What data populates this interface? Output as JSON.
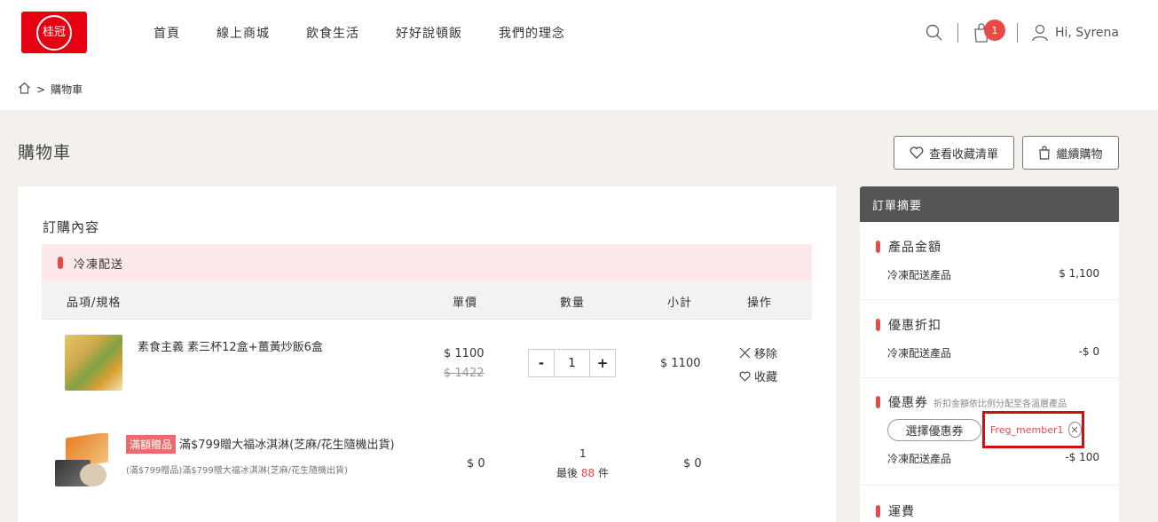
{
  "header": {
    "logo_text": "桂冠",
    "nav": [
      "首頁",
      "線上商城",
      "飲食生活",
      "好好說頓飯",
      "我們的理念"
    ],
    "cart_count": "1",
    "greeting": "Hi, Syrena"
  },
  "breadcrumb": {
    "separator": ">",
    "current": "購物車"
  },
  "page": {
    "title": "購物車",
    "view_favorites": "查看收藏清單",
    "continue_shopping": "繼續購物"
  },
  "order": {
    "title": "訂購內容",
    "shipping_group": "冷凍配送",
    "columns": {
      "item": "品項/規格",
      "unit_price": "單價",
      "quantity": "數量",
      "subtotal": "小計",
      "actions": "操作"
    },
    "items": [
      {
        "name": "素食主義 素三杯12盒+薑黃炒飯6盒",
        "price": "$ 1100",
        "original_price": "$ 1422",
        "quantity": "1",
        "subtotal": "$ 1100",
        "remove_label": "移除",
        "favorite_label": "收藏",
        "minus": "-",
        "plus": "+"
      },
      {
        "tag": "滿額贈品",
        "name": "滿$799贈大福冰淇淋(芝麻/花生隨機出貨)",
        "sub": "(滿$799贈品)滿$799贈大福冰淇淋(芝麻/花生隨機出貨)",
        "price": "$ 0",
        "quantity": "1",
        "stock_prefix": "最後",
        "stock_count": "88",
        "stock_suffix": "件",
        "subtotal": "$ 0"
      }
    ]
  },
  "summary": {
    "title": "訂單摘要",
    "product_amount": {
      "title": "產品金額",
      "label": "冷凍配送產品",
      "value": "$ 1,100"
    },
    "discount": {
      "title": "優惠折扣",
      "label": "冷凍配送產品",
      "value": "-$ 0"
    },
    "coupon": {
      "title": "優惠券",
      "note": "折扣金額依比例分配至各溫層產品",
      "select_label": "選擇優惠券",
      "applied_code": "Freg_member1",
      "label": "冷凍配送產品",
      "value": "-$ 100"
    },
    "shipping": {
      "title": "運費"
    }
  },
  "colors": {
    "brand_red": "#e60012",
    "accent_red": "#e84a47",
    "summary_header": "#555555"
  }
}
